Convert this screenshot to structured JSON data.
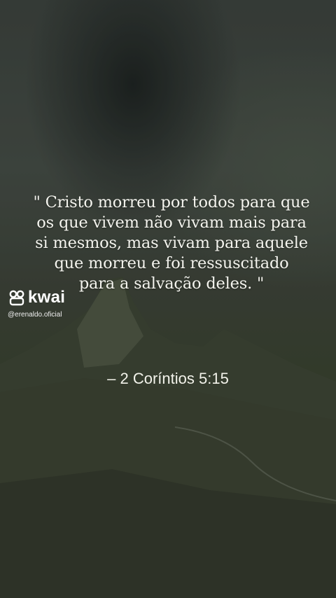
{
  "quote": {
    "lines": [
      "\" Cristo morreu por todos para que",
      "os que vivem não vivam mais para",
      "si mesmos, mas vivam para aquele",
      "que morreu e foi ressuscitado",
      "para a salvação deles. \""
    ]
  },
  "reference": "– 2 Coríntios 5:15",
  "watermark": {
    "brand": "kwai",
    "handle": "@erenaldo.oficial",
    "icon": "kwai-logo-icon"
  },
  "colors": {
    "text": "#f4f4ee",
    "sky": "#3b423d",
    "hills": "#3a4230"
  }
}
